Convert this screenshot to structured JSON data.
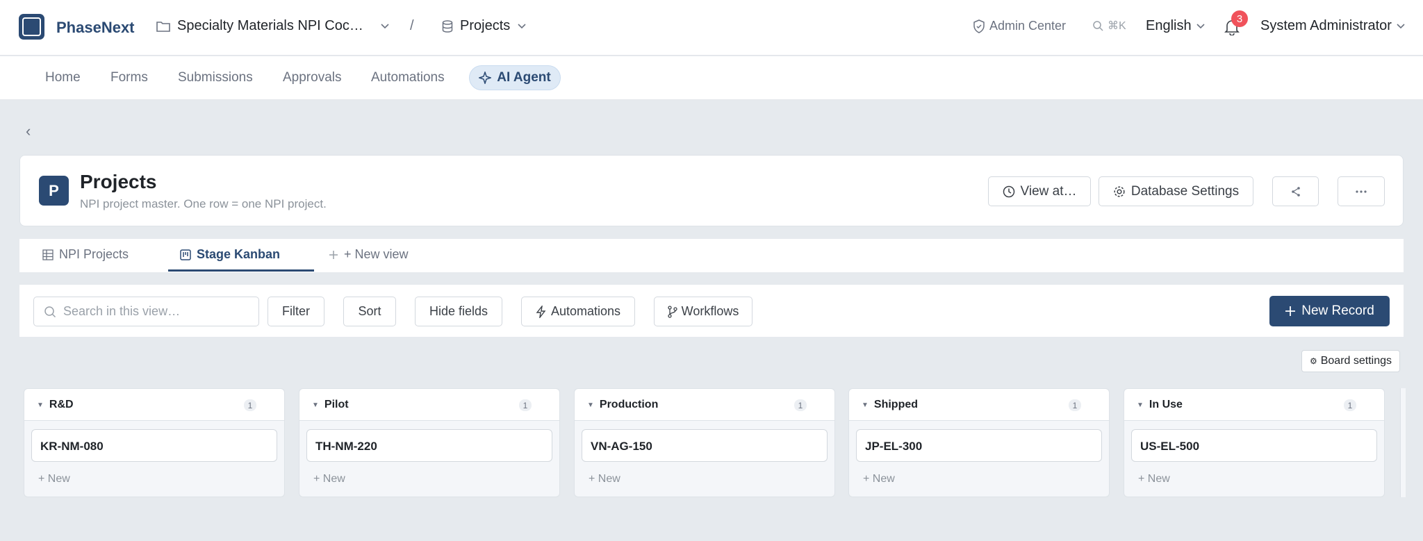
{
  "header": {
    "brand": "PhaseNext",
    "workspace": "Specialty Materials NPI Coc…",
    "separator": "/",
    "database": "Projects",
    "admin_center": "Admin Center",
    "search_shortcut": "⌘K",
    "language": "English",
    "notification_count": "3",
    "user": "System Administrator"
  },
  "nav": {
    "items": [
      "Home",
      "Forms",
      "Submissions",
      "Approvals",
      "Automations"
    ],
    "ai_agent": "AI Agent"
  },
  "page": {
    "icon_letter": "P",
    "title": "Projects",
    "description": "NPI project master. One row = one NPI project.",
    "view_at": "View at…",
    "database_settings": "Database Settings"
  },
  "tabs": {
    "items": [
      "NPI Projects",
      "Stage Kanban"
    ],
    "active": "Stage Kanban",
    "new_view": "+ New view"
  },
  "toolbar": {
    "search_placeholder": "Search in this view…",
    "filter": "Filter",
    "sort": "Sort",
    "hide_fields": "Hide fields",
    "automations": "Automations",
    "workflows": "Workflows",
    "new_record": "New Record"
  },
  "board": {
    "settings_label": "Board settings",
    "new_label": "New",
    "columns": [
      {
        "title": "R&D",
        "count": "1",
        "card": "KR-NM-080"
      },
      {
        "title": "Pilot",
        "count": "1",
        "card": "TH-NM-220"
      },
      {
        "title": "Production",
        "count": "1",
        "card": "VN-AG-150"
      },
      {
        "title": "Shipped",
        "count": "1",
        "card": "JP-EL-300"
      },
      {
        "title": "In Use",
        "count": "1",
        "card": "US-EL-500"
      }
    ]
  },
  "colors": {
    "brand": "#2b4a73",
    "badge": "#f0525b",
    "background": "#e6eaee"
  }
}
